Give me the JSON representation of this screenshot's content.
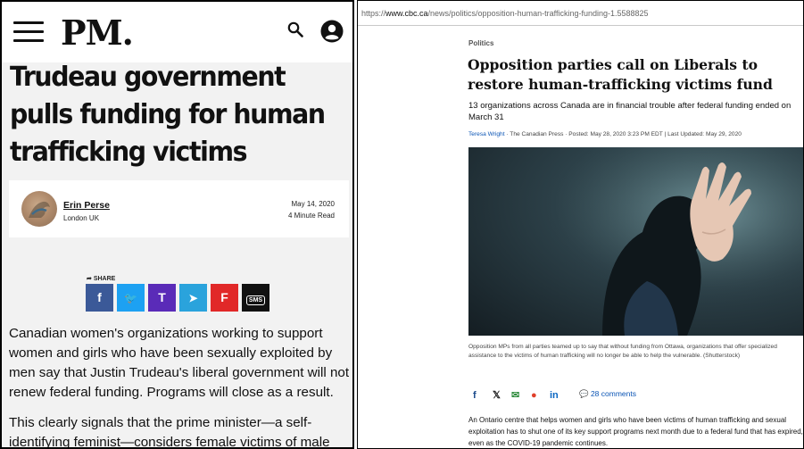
{
  "left": {
    "logo": "PM.",
    "title": "Trudeau government pulls funding for human trafficking victims",
    "author": {
      "name": "Erin Perse",
      "location": "London UK"
    },
    "date": "May 14, 2020",
    "read_time": "4 Minute Read",
    "share_label": "SHARE",
    "share_buttons": [
      {
        "icon": "facebook-icon",
        "glyph": "f",
        "color": "#3b5998"
      },
      {
        "icon": "twitter-icon",
        "glyph": "🐦",
        "color": "#1da1f2"
      },
      {
        "icon": "tumblr-icon",
        "glyph": "T",
        "color": "#5a2bb8"
      },
      {
        "icon": "telegram-icon",
        "glyph": "➤",
        "color": "#2aa3dc"
      },
      {
        "icon": "flipboard-icon",
        "glyph": "F",
        "color": "#e12828"
      },
      {
        "icon": "sms-icon",
        "glyph": "SMS",
        "color": "#111111"
      }
    ],
    "paragraphs": [
      "Canadian women's organizations working to support women and girls who have been sexually exploited by men say that Justin Trudeau's liberal government will not renew federal funding. Programs will close as a result.",
      "This clearly signals that the prime minister—a self-identifying feminist—considers female victims of male"
    ]
  },
  "right": {
    "url_prefix": "https://",
    "url_host": "www.cbc.ca",
    "url_path": "/news/politics/opposition-human-trafficking-funding-1.5588825",
    "section": "Politics",
    "title": "Opposition parties call on Liberals to restore human-trafficking victims fund",
    "deck": "13 organizations across Canada are in financial trouble after federal funding ended on March 31",
    "byline_author": "Teresa Wright",
    "byline_rest": " · The Canadian Press · Posted: May 28, 2020 3:23 PM EDT | Last Updated: May 29, 2020",
    "caption": "Opposition MPs from all parties teamed up to say that without funding from Ottawa, organizations that offer specialized assistance to the victims of human trafficking will no longer be able to help the vulnerable. (Shutterstock)",
    "share_icons": [
      {
        "icon": "facebook-icon",
        "glyph": "f",
        "color": "#1a4a8a"
      },
      {
        "icon": "x-icon",
        "glyph": "𝕏",
        "color": "#111111"
      },
      {
        "icon": "email-icon",
        "glyph": "✉",
        "color": "#2e8b3c"
      },
      {
        "icon": "reddit-icon",
        "glyph": "●",
        "color": "#e0402b"
      },
      {
        "icon": "linkedin-icon",
        "glyph": "in",
        "color": "#0a66c2"
      }
    ],
    "comments": "28 comments",
    "body": "An Ontario centre that helps women and girls who have been victims of human trafficking and sexual exploitation has to shut one of its key support programs next month due to a federal fund that has expired, even as the COVID-19 pandemic continues."
  }
}
